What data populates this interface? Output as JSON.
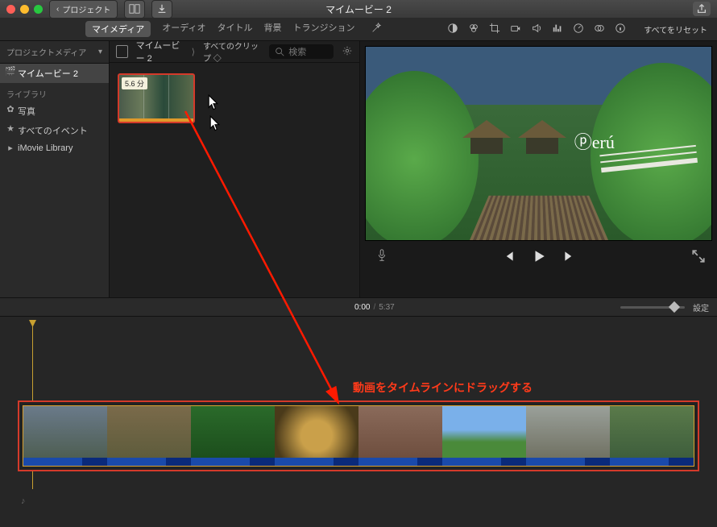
{
  "window": {
    "title": "マイムービー 2",
    "back_label": "プロジェクト"
  },
  "tabs": {
    "items": [
      "マイメディア",
      "オーディオ",
      "タイトル",
      "背景",
      "トランジション"
    ],
    "active_index": 0
  },
  "tools_right": {
    "reset_label": "すべてをリセット"
  },
  "sidebar": {
    "header": "プロジェクトメディア",
    "project_name": "マイムービー 2",
    "group_label": "ライブラリ",
    "items": [
      {
        "icon": "flower",
        "label": "写真"
      },
      {
        "icon": "star",
        "label": "すべてのイベント"
      },
      {
        "icon": "tri",
        "label": "iMovie Library"
      }
    ]
  },
  "browser": {
    "breadcrumb": "マイムービー 2",
    "filter_label": "すべてのクリップ",
    "search_placeholder": "検索",
    "clip_duration": "5.6 分"
  },
  "viewer": {
    "logo_text": "erú"
  },
  "transport": {
    "current_time": "0:00",
    "total_time": "5:37",
    "settings_label": "設定"
  },
  "annotation": {
    "text": "動画をタイムラインにドラッグする"
  },
  "colors": {
    "highlight": "#d43a2a"
  }
}
